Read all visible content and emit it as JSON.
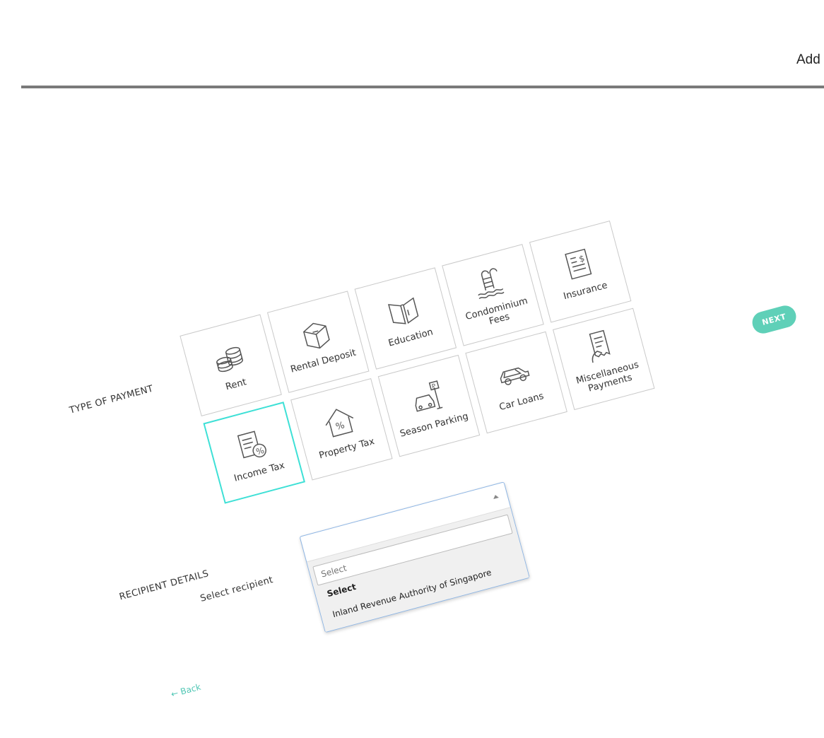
{
  "header": {
    "right_label": "Add"
  },
  "type_of_payment": {
    "label": "TYPE OF PAYMENT",
    "tiles": [
      {
        "label": "Rent",
        "icon": "coins-icon"
      },
      {
        "label": "Rental Deposit",
        "icon": "box-icon"
      },
      {
        "label": "Education",
        "icon": "book-icon"
      },
      {
        "label": "Condominium Fees",
        "icon": "pool-ladder-icon"
      },
      {
        "label": "Insurance",
        "icon": "document-dollar-icon"
      },
      {
        "label": "Income Tax",
        "icon": "tax-document-icon",
        "selected": true
      },
      {
        "label": "Property Tax",
        "icon": "house-percent-icon"
      },
      {
        "label": "Season Parking",
        "icon": "car-parking-icon"
      },
      {
        "label": "Car Loans",
        "icon": "car-icon"
      },
      {
        "label": "Miscellaneous Payments",
        "icon": "receipt-hand-icon"
      }
    ]
  },
  "next_button": {
    "label": "NEXT"
  },
  "recipient": {
    "section_label": "RECIPIENT DETAILS",
    "field_label": "Select recipient",
    "search_placeholder": "Select",
    "options": [
      "Select",
      "Inland Revenue Authority of Singapore"
    ]
  },
  "back_link": {
    "label": "← Back"
  },
  "colors": {
    "accent": "#3ee0d6",
    "button": "#5fd0b8",
    "divider": "#7a7a7a"
  }
}
